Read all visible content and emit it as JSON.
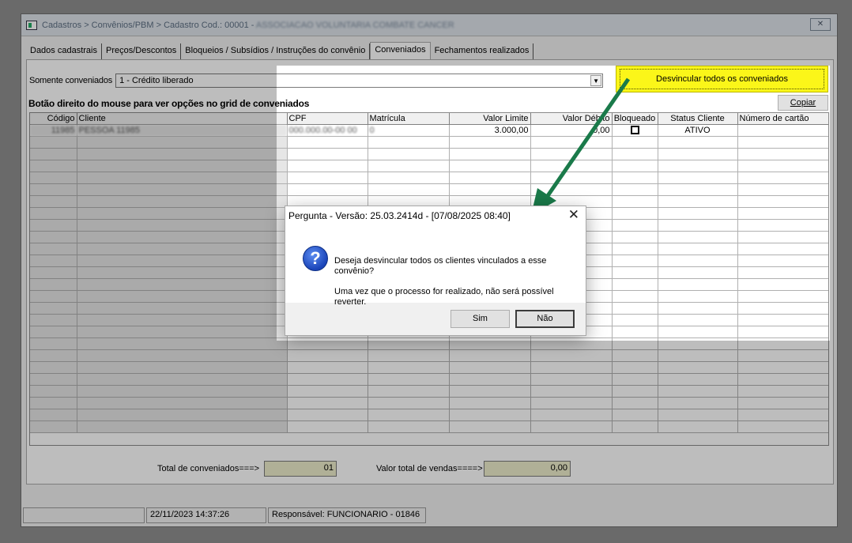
{
  "window": {
    "title_prefix": "Cadastros > Convênios/PBM > Cadastro  Cod.: 00001 - ",
    "title_name": "ASSOCIACAO VOLUNTARIA COMBATE CANCER"
  },
  "tabs": [
    {
      "label": "Dados cadastrais"
    },
    {
      "label": "Preços/Descontos"
    },
    {
      "label": "Bloqueios / Subsídios / Instruções do convênio"
    },
    {
      "label": "Conveniados"
    },
    {
      "label": "Fechamentos realizados"
    }
  ],
  "filter": {
    "label": "Somente conveniados",
    "value": "1 - Crédito liberado"
  },
  "buttons": {
    "unlink_all": "Desvincular todos os conveniados",
    "copy": "Copiar"
  },
  "hint": "Botão direito do mouse para ver opções no grid de conveniados",
  "grid": {
    "columns": [
      "Código",
      "Cliente",
      "CPF",
      "Matrícula",
      "Valor Limite",
      "Valor Débito",
      "Bloqueado",
      "Status Cliente",
      "Número de cartão"
    ],
    "rows": [
      {
        "codigo": "11985",
        "cliente": "PESSOA 11985",
        "cpf": "000.000.00-00 00",
        "matricula": "0",
        "valor_limite": "3.000,00",
        "valor_debito": "0,00",
        "bloqueado": false,
        "status": "ATIVO",
        "cartao": ""
      }
    ]
  },
  "totals": {
    "conveniados_label": "Total de conveniados===>",
    "conveniados_value": "01",
    "vendas_label": "Valor total de vendas====>",
    "vendas_value": "0,00"
  },
  "status": {
    "datetime": "22/11/2023 14:37:26",
    "responsavel": "Responsável: FUNCIONARIO - 01846"
  },
  "dialog": {
    "title": "Pergunta - Versão: 25.03.2414d - [07/08/2025 08:40]",
    "close": "✕",
    "icon": "?",
    "message_line1": "Deseja desvincular todos os clientes vinculados a esse convênio?",
    "message_line2": "Uma vez que o processo for realizado, não será possível reverter.",
    "yes": "Sim",
    "no": "Não"
  },
  "icons": {
    "annotation_arrow_color": "#1a7a4a",
    "highlight_color": "#fbf619",
    "question_icon": "question-icon"
  }
}
